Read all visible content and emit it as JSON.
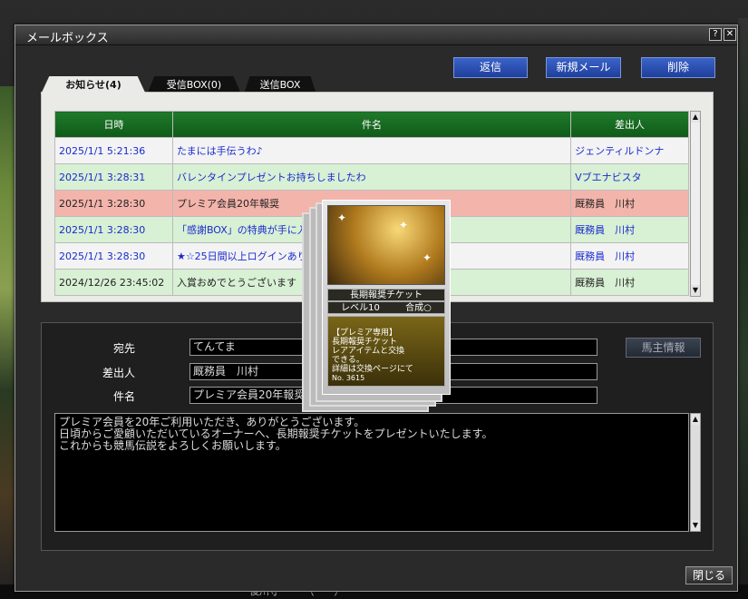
{
  "window": {
    "title": "メールボックス",
    "help_label": "?",
    "close_label": "✕"
  },
  "toolbar": {
    "reply": "返信",
    "new_mail": "新規メール",
    "delete": "削除"
  },
  "tabs": [
    {
      "label": "お知らせ(4)",
      "active": true
    },
    {
      "label": "受信BOX(0)",
      "active": false
    },
    {
      "label": "送信BOX",
      "active": false
    }
  ],
  "table": {
    "headers": [
      "日時",
      "件名",
      "差出人"
    ],
    "rows": [
      {
        "date": "2025/1/1 5:21:36",
        "subject": "たまには手伝うわ♪",
        "sender": "ジェンティルドンナ"
      },
      {
        "date": "2025/1/1 3:28:31",
        "subject": "バレンタインプレゼントお持ちしましたわ",
        "sender": "Vブエナビスタ"
      },
      {
        "date": "2025/1/1 3:28:30",
        "subject": "プレミア会員20年報奨",
        "sender": "厩務員　川村"
      },
      {
        "date": "2025/1/1 3:28:30",
        "subject": "「感謝BOX」の特典が手に入",
        "sender": "厩務員　川村"
      },
      {
        "date": "2025/1/1 3:28:30",
        "subject": "★☆25日間以上ログインあり",
        "sender": "厩務員　川村"
      },
      {
        "date": "2024/12/26 23:45:02",
        "subject": "入賞おめでとうございます",
        "sender": "厩務員　川村"
      }
    ]
  },
  "detail": {
    "to_label": "宛先",
    "to_value": "てんてま",
    "from_label": "差出人",
    "from_value": "厩務員　川村",
    "subject_label": "件名",
    "subject_value": "プレミア会員20年報奨",
    "owner_button": "馬主情報",
    "body": "プレミア会員を20年ご利用いただき、ありがとうございます。\n日頃からご愛顧いただいているオーナーへ、長期報奨チケットをプレゼントいたします。\nこれからも競馬伝説をよろしくお願いします。"
  },
  "close_button": "閉じる",
  "card": {
    "name": "長期報奨チケット",
    "level": "レベル10",
    "fusion": "合成○",
    "desc": "【プレミア専用】\n長期報奨チケット\nレアアイテムと交換\nできる。\n詳細は交換ページにて",
    "number": "No. 3615"
  },
  "background": {
    "bottom_text": "後川守　　　（ー－）"
  }
}
